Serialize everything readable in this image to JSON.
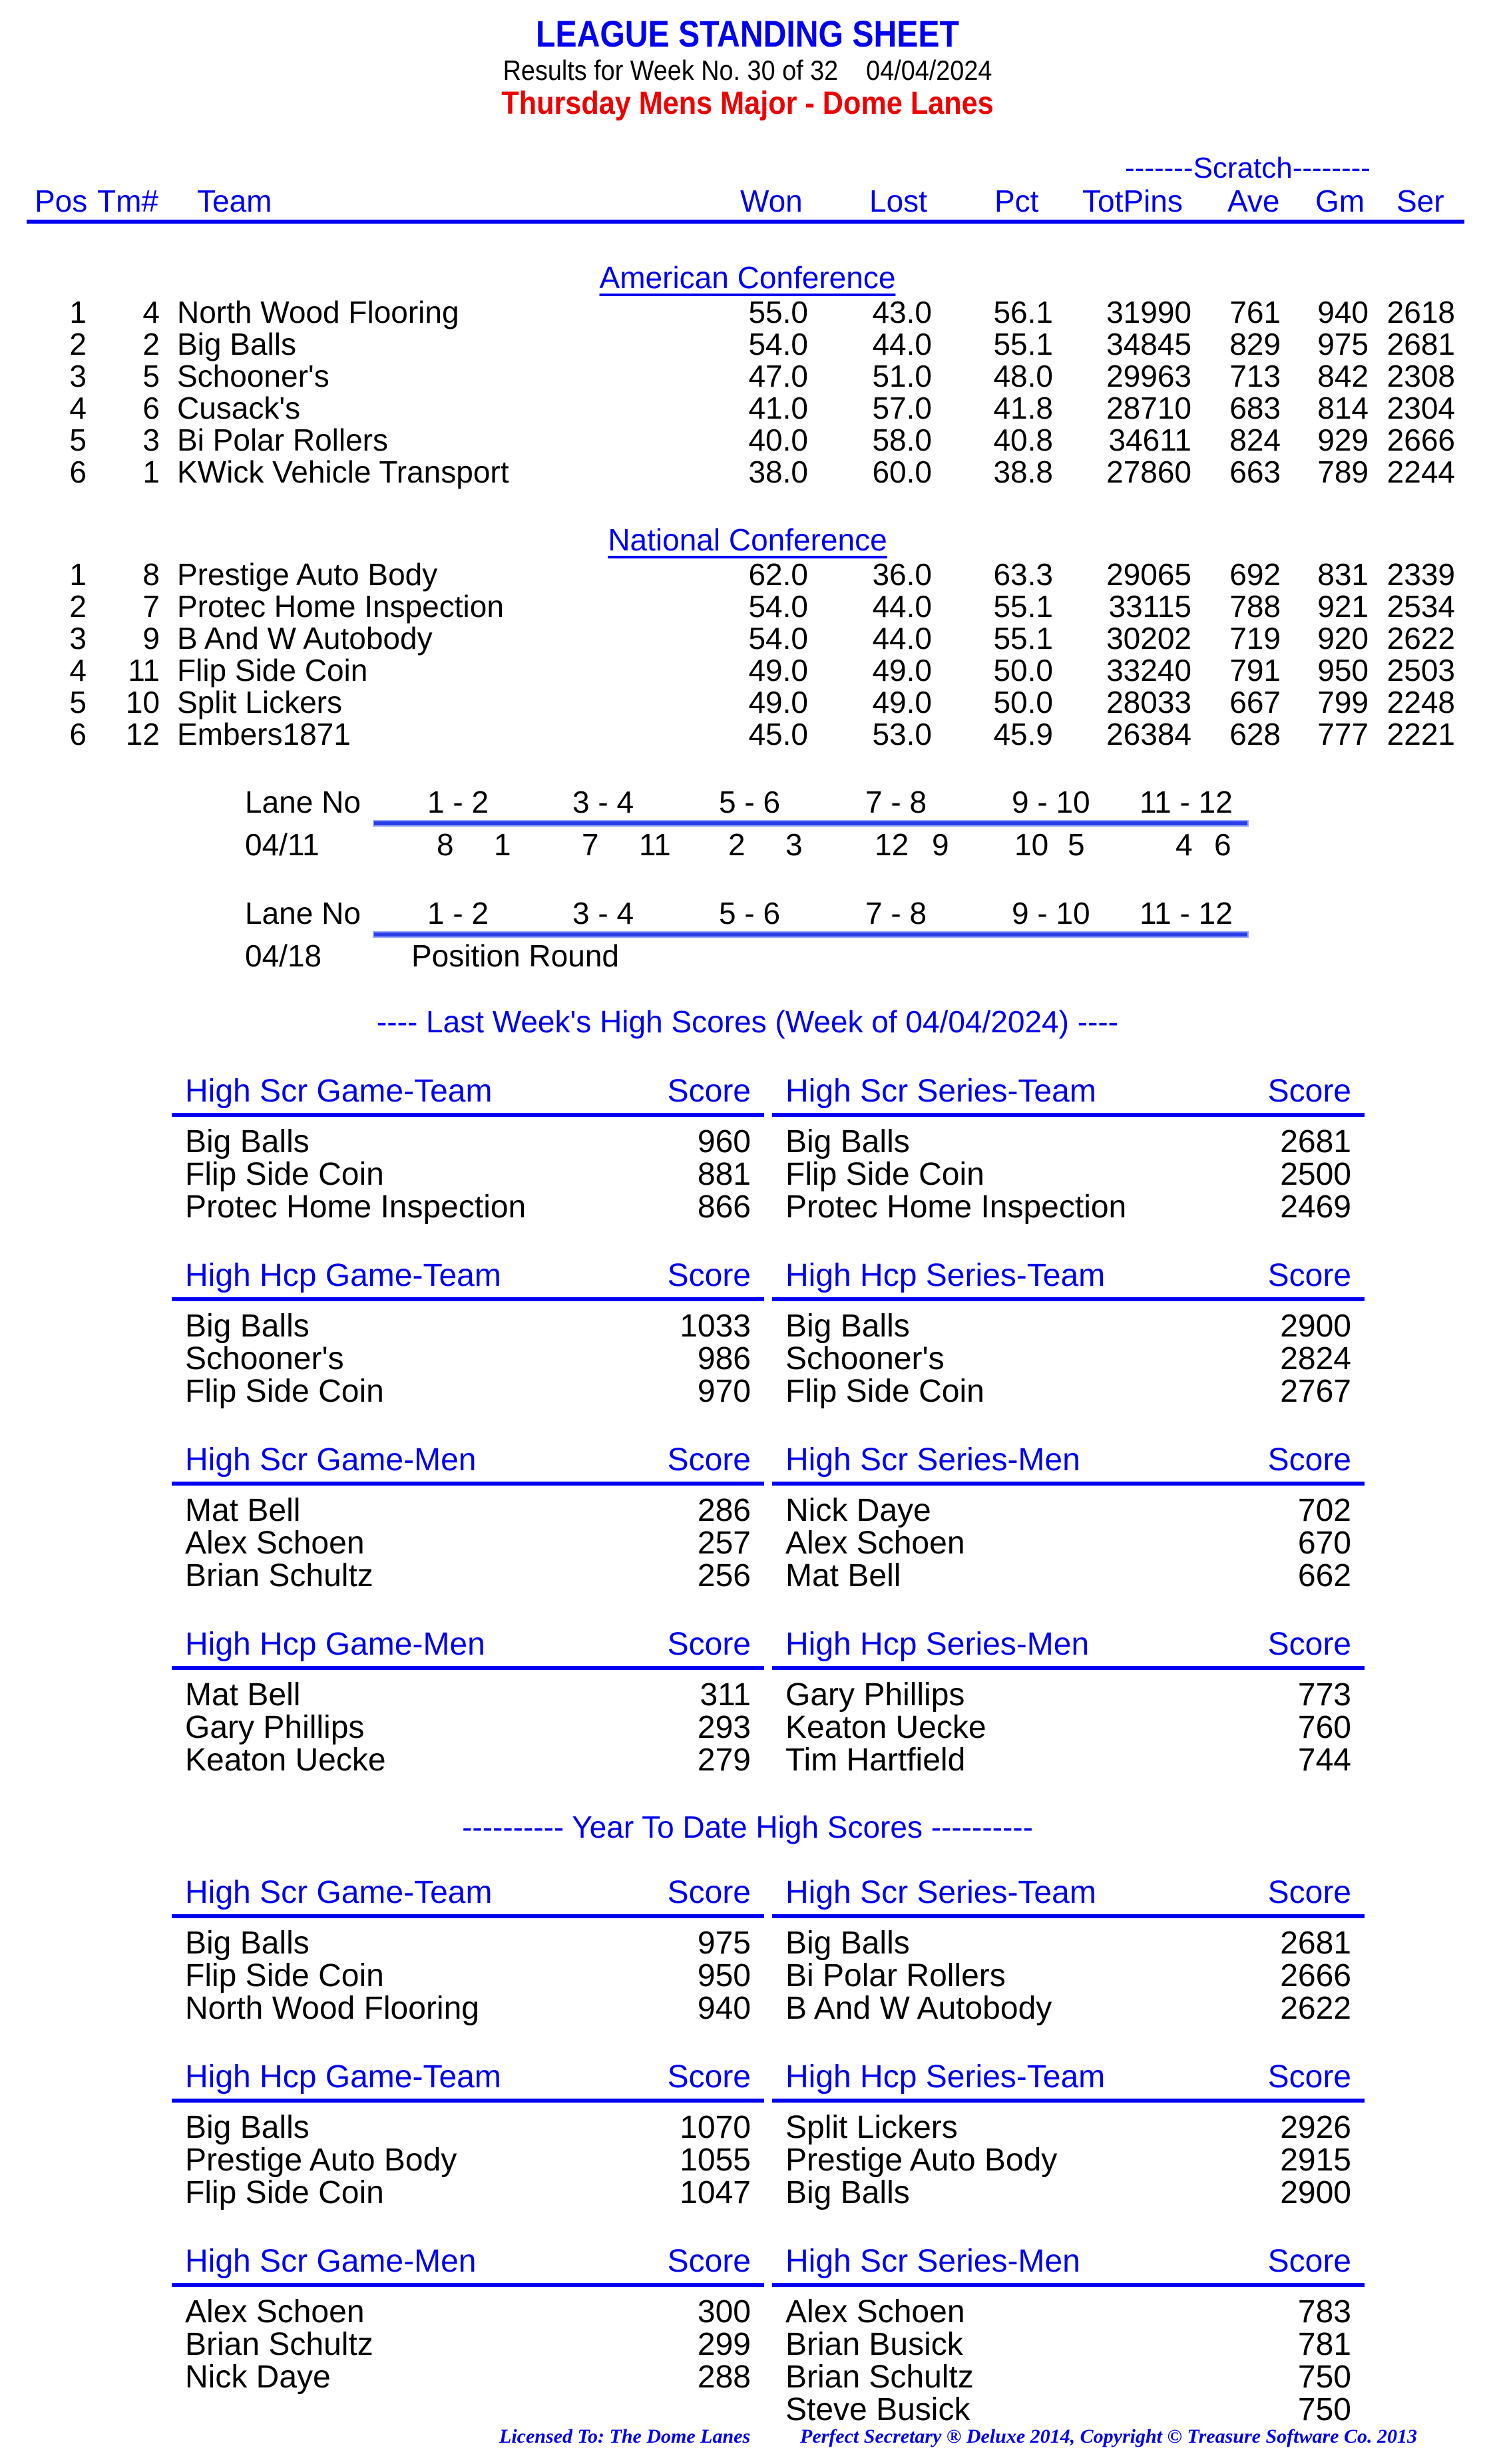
{
  "header": {
    "title": "LEAGUE STANDING SHEET",
    "subtitle": "Results for Week No. 30 of 32    04/04/2024",
    "league": "Thursday Mens Major - Dome Lanes",
    "scratch_label": "-------Scratch--------"
  },
  "columns": {
    "pos": "Pos",
    "tm": "Tm#",
    "team": "Team",
    "won": "Won",
    "lost": "Lost",
    "pct": "Pct",
    "totpins": "TotPins",
    "ave": "Ave",
    "gm": "Gm",
    "ser": "Ser"
  },
  "conferences": [
    {
      "name": "American Conference",
      "rows": [
        {
          "pos": "1",
          "tm": "4",
          "team": "North Wood Flooring",
          "won": "55.0",
          "lost": "43.0",
          "pct": "56.1",
          "totpins": "31990",
          "ave": "761",
          "gm": "940",
          "ser": "2618"
        },
        {
          "pos": "2",
          "tm": "2",
          "team": "Big Balls",
          "won": "54.0",
          "lost": "44.0",
          "pct": "55.1",
          "totpins": "34845",
          "ave": "829",
          "gm": "975",
          "ser": "2681"
        },
        {
          "pos": "3",
          "tm": "5",
          "team": "Schooner's",
          "won": "47.0",
          "lost": "51.0",
          "pct": "48.0",
          "totpins": "29963",
          "ave": "713",
          "gm": "842",
          "ser": "2308"
        },
        {
          "pos": "4",
          "tm": "6",
          "team": "Cusack's",
          "won": "41.0",
          "lost": "57.0",
          "pct": "41.8",
          "totpins": "28710",
          "ave": "683",
          "gm": "814",
          "ser": "2304"
        },
        {
          "pos": "5",
          "tm": "3",
          "team": "Bi Polar Rollers",
          "won": "40.0",
          "lost": "58.0",
          "pct": "40.8",
          "totpins": "34611",
          "ave": "824",
          "gm": "929",
          "ser": "2666"
        },
        {
          "pos": "6",
          "tm": "1",
          "team": "KWick Vehicle Transport",
          "won": "38.0",
          "lost": "60.0",
          "pct": "38.8",
          "totpins": "27860",
          "ave": "663",
          "gm": "789",
          "ser": "2244"
        }
      ]
    },
    {
      "name": "National Conference",
      "rows": [
        {
          "pos": "1",
          "tm": "8",
          "team": "Prestige Auto Body",
          "won": "62.0",
          "lost": "36.0",
          "pct": "63.3",
          "totpins": "29065",
          "ave": "692",
          "gm": "831",
          "ser": "2339"
        },
        {
          "pos": "2",
          "tm": "7",
          "team": "Protec Home Inspection",
          "won": "54.0",
          "lost": "44.0",
          "pct": "55.1",
          "totpins": "33115",
          "ave": "788",
          "gm": "921",
          "ser": "2534"
        },
        {
          "pos": "3",
          "tm": "9",
          "team": "B And W Autobody",
          "won": "54.0",
          "lost": "44.0",
          "pct": "55.1",
          "totpins": "30202",
          "ave": "719",
          "gm": "920",
          "ser": "2622"
        },
        {
          "pos": "4",
          "tm": "11",
          "team": "Flip Side Coin",
          "won": "49.0",
          "lost": "49.0",
          "pct": "50.0",
          "totpins": "33240",
          "ave": "791",
          "gm": "950",
          "ser": "2503"
        },
        {
          "pos": "5",
          "tm": "10",
          "team": "Split Lickers",
          "won": "49.0",
          "lost": "49.0",
          "pct": "50.0",
          "totpins": "28033",
          "ave": "667",
          "gm": "799",
          "ser": "2248"
        },
        {
          "pos": "6",
          "tm": "12",
          "team": "Embers1871",
          "won": "45.0",
          "lost": "53.0",
          "pct": "45.9",
          "totpins": "26384",
          "ave": "628",
          "gm": "777",
          "ser": "2221"
        }
      ]
    }
  ],
  "lanes": {
    "label": "Lane No",
    "pairs": [
      "1 - 2",
      "3 - 4",
      "5 - 6",
      "7 - 8",
      "9 - 10",
      "11 - 12"
    ],
    "schedule": [
      {
        "date": "04/11",
        "matchups": [
          [
            "8",
            "1"
          ],
          [
            "7",
            "11"
          ],
          [
            "2",
            "3"
          ],
          [
            "12",
            "9"
          ],
          [
            "10",
            "5"
          ],
          [
            "4",
            "6"
          ]
        ]
      },
      {
        "date": "04/18",
        "note": "Position Round"
      }
    ]
  },
  "last_week": {
    "title": "----  Last Week's High Scores   (Week of 04/04/2024)  ----",
    "boxes": [
      {
        "title": "High Scr Game-Team",
        "score": "Score",
        "items": [
          [
            "Big Balls",
            "960"
          ],
          [
            "Flip Side Coin",
            "881"
          ],
          [
            "Protec Home Inspection",
            "866"
          ]
        ]
      },
      {
        "title": "High Scr Series-Team",
        "score": "Score",
        "items": [
          [
            "Big Balls",
            "2681"
          ],
          [
            "Flip Side Coin",
            "2500"
          ],
          [
            "Protec Home Inspection",
            "2469"
          ]
        ]
      },
      {
        "title": "High Hcp Game-Team",
        "score": "Score",
        "items": [
          [
            "Big Balls",
            "1033"
          ],
          [
            "Schooner's",
            "986"
          ],
          [
            "Flip Side Coin",
            "970"
          ]
        ]
      },
      {
        "title": "High Hcp Series-Team",
        "score": "Score",
        "items": [
          [
            "Big Balls",
            "2900"
          ],
          [
            "Schooner's",
            "2824"
          ],
          [
            "Flip Side Coin",
            "2767"
          ]
        ]
      },
      {
        "title": "High Scr Game-Men",
        "score": "Score",
        "items": [
          [
            "Mat Bell",
            "286"
          ],
          [
            "Alex Schoen",
            "257"
          ],
          [
            "Brian Schultz",
            "256"
          ]
        ]
      },
      {
        "title": "High Scr Series-Men",
        "score": "Score",
        "items": [
          [
            "Nick Daye",
            "702"
          ],
          [
            "Alex Schoen",
            "670"
          ],
          [
            "Mat Bell",
            "662"
          ]
        ]
      },
      {
        "title": "High Hcp Game-Men",
        "score": "Score",
        "items": [
          [
            "Mat Bell",
            "311"
          ],
          [
            "Gary Phillips",
            "293"
          ],
          [
            "Keaton Uecke",
            "279"
          ]
        ]
      },
      {
        "title": "High Hcp Series-Men",
        "score": "Score",
        "items": [
          [
            "Gary Phillips",
            "773"
          ],
          [
            "Keaton Uecke",
            "760"
          ],
          [
            "Tim Hartfield",
            "744"
          ]
        ]
      }
    ]
  },
  "year_to_date": {
    "title": "---------- Year To Date High Scores ----------",
    "boxes": [
      {
        "title": "High Scr Game-Team",
        "score": "Score",
        "items": [
          [
            "Big Balls",
            "975"
          ],
          [
            "Flip Side Coin",
            "950"
          ],
          [
            "North Wood Flooring",
            "940"
          ]
        ]
      },
      {
        "title": "High Scr Series-Team",
        "score": "Score",
        "items": [
          [
            "Big Balls",
            "2681"
          ],
          [
            "Bi Polar Rollers",
            "2666"
          ],
          [
            "B And W Autobody",
            "2622"
          ]
        ]
      },
      {
        "title": "High Hcp Game-Team",
        "score": "Score",
        "items": [
          [
            "Big Balls",
            "1070"
          ],
          [
            "Prestige Auto Body",
            "1055"
          ],
          [
            "Flip Side Coin",
            "1047"
          ]
        ]
      },
      {
        "title": "High Hcp Series-Team",
        "score": "Score",
        "items": [
          [
            "Split Lickers",
            "2926"
          ],
          [
            "Prestige Auto Body",
            "2915"
          ],
          [
            "Big Balls",
            "2900"
          ]
        ]
      },
      {
        "title": "High Scr Game-Men",
        "score": "Score",
        "items": [
          [
            "Alex Schoen",
            "300"
          ],
          [
            "Brian Schultz",
            "299"
          ],
          [
            "Nick Daye",
            "288"
          ]
        ]
      },
      {
        "title": "High Scr Series-Men",
        "score": "Score",
        "items": [
          [
            "Alex Schoen",
            "783"
          ],
          [
            "Brian Busick",
            "781"
          ],
          [
            "Brian Schultz",
            "750"
          ],
          [
            "Steve Busick",
            "750"
          ]
        ]
      }
    ]
  },
  "footer": {
    "licensed": "Licensed To: The Dome Lanes",
    "software": "Perfect Secretary ® Deluxe  2014, Copyright © Treasure Software Co. 2013"
  }
}
